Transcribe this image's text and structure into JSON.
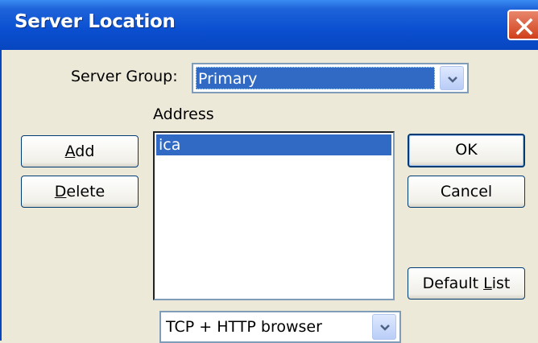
{
  "window": {
    "title": "Server Location"
  },
  "server_group": {
    "label": "Server Group:",
    "value": "Primary"
  },
  "address_list": {
    "label": "Address",
    "items": [
      "ica"
    ]
  },
  "buttons": {
    "add": {
      "prefix": "",
      "mnemonic": "A",
      "suffix": "dd"
    },
    "delete": {
      "prefix": "",
      "mnemonic": "D",
      "suffix": "elete"
    },
    "ok": {
      "label": "OK"
    },
    "cancel": {
      "label": "Cancel"
    },
    "default_list": {
      "prefix": "Default ",
      "mnemonic": "L",
      "suffix": "ist"
    }
  },
  "protocol": {
    "value": "TCP + HTTP browser"
  },
  "colors": {
    "titlebar": "#0a4fd0",
    "selection": "#316ac5",
    "dialog": "#ece9d8",
    "close": "#d0401a"
  },
  "icons": {
    "close": "close-icon",
    "dropdown": "chevron-down-icon"
  }
}
